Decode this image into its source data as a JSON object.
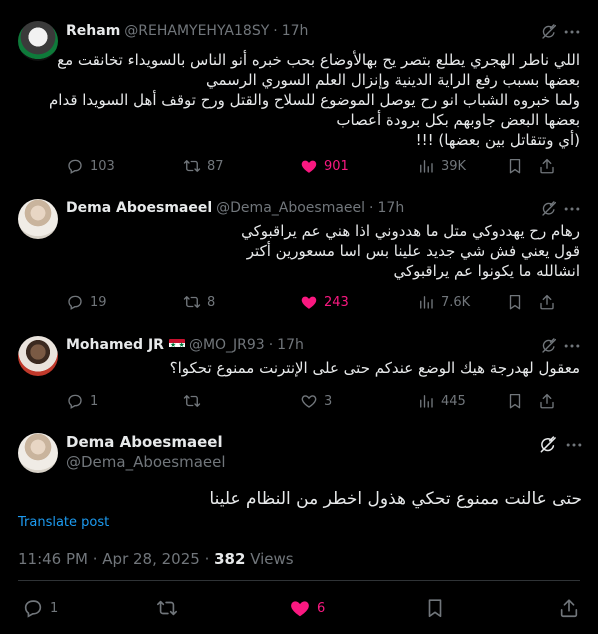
{
  "replies": [
    {
      "name": "Reham",
      "handle": "@REHAMYEHYA18SY",
      "time": "17h",
      "lines": [
        "اللي ناطر الهجري يطلع بتصر يح بهالأوضاع بحب خبره أنو الناس بالسويداء تخانقت مع",
        "بعضها بسبب رفع الراية الدينية وإنزال العلم السوري الرسمي",
        "ولما خبروه الشباب انو رح يوصل الموضوع للسلاح والقتل ورح توقف أهل السويدا قدام",
        "بعضها البعض جاوبهم بكل برودة أعصاب",
        "(أي وتتقاتل بين بعضها) !!!"
      ],
      "reply_count": "103",
      "repost_count": "87",
      "like_count": "901",
      "views": "39K"
    },
    {
      "name": "Dema Aboesmaeel",
      "handle": "@Dema_Aboesmaeel",
      "time": "17h",
      "lines": [
        "رهام رح يهددوكي متل ما هددوني اذا هني عم يراقبوكي",
        "قول يعني فش شي جديد علينا بس اسا مسعورين أكتر",
        "انشالله ما يكونوا عم يراقبوكي"
      ],
      "reply_count": "19",
      "repost_count": "8",
      "like_count": "243",
      "views": "7.6K"
    },
    {
      "name": "Mohamed JR",
      "flag": "iraq-flag",
      "handle": "@MO_JR93",
      "time": "17h",
      "lines": [
        "معقول لهدرجة هيك الوضع عندكم حتى على الإنترنت ممنوع تحكوا؟"
      ],
      "reply_count": "1",
      "repost_count": "",
      "like_count": "3",
      "views": "445"
    }
  ],
  "main": {
    "name": "Dema Aboesmaeel",
    "handle": "@Dema_Aboesmaeel",
    "text": "حتى عالنت ممنوع تحكي هذول اخطر من النظام علينا",
    "translate": "Translate post",
    "timestamp": "11:46 PM · Apr 28, 2025 · ",
    "views_count": "382",
    "views_label": " Views",
    "reply_count": "1",
    "like_count": "6"
  },
  "colors": {
    "background": "#000000",
    "text": "#e7e9ea",
    "muted": "#71767b",
    "like": "#f91880",
    "link": "#1d9bf0",
    "divider": "#2f3336"
  }
}
